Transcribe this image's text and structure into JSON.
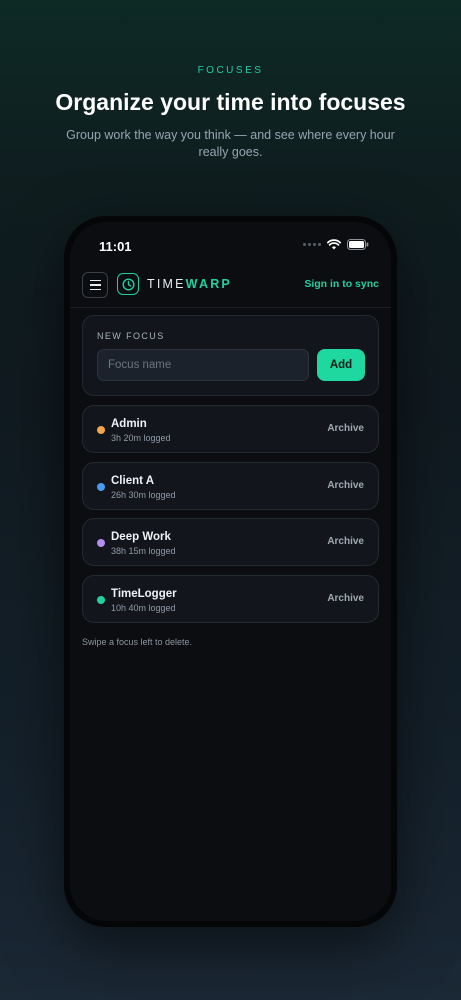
{
  "hero": {
    "eyebrow": "FOCUSES",
    "headline": "Organize your time into focuses",
    "subhead": "Group work the way you think — and see where every hour really goes."
  },
  "status_bar": {
    "time": "11:01",
    "icons": [
      "signal-icon",
      "wifi-icon",
      "battery-icon"
    ]
  },
  "header": {
    "menu_icon": "hamburger-icon",
    "logo_icon": "clock-icon",
    "logo_light": "TIME",
    "logo_bold": "WARP",
    "sign_in": "Sign in to sync"
  },
  "new_focus": {
    "label": "NEW FOCUS",
    "placeholder": "Focus name",
    "value": "",
    "add_label": "Add"
  },
  "focuses": [
    {
      "name": "Admin",
      "logged": "3h 20m logged",
      "color": "#f0a54a",
      "action": "Archive"
    },
    {
      "name": "Client A",
      "logged": "26h 30m logged",
      "color": "#4a9cf0",
      "action": "Archive"
    },
    {
      "name": "Deep Work",
      "logged": "38h 15m logged",
      "color": "#b48cf2",
      "action": "Archive"
    },
    {
      "name": "TimeLogger",
      "logged": "10h 40m logged",
      "color": "#1fd0a0",
      "action": "Archive"
    }
  ],
  "hint": "Swipe a focus left to delete.",
  "colors": {
    "accent": "#1fd0a0",
    "background": "#0b0d10"
  }
}
